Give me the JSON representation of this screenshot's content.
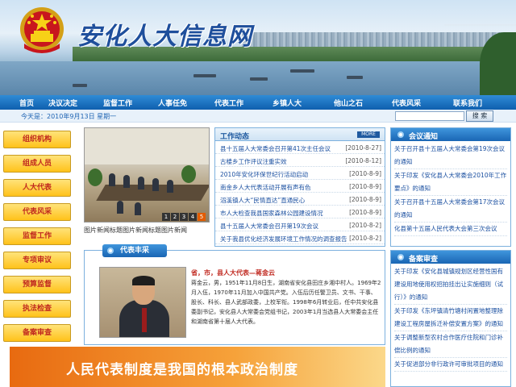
{
  "header": {
    "site_title": "安化人大信息网",
    "emblem_icon": "national-emblem-icon"
  },
  "nav": {
    "items": [
      "首页",
      "决议决定",
      "监督工作",
      "人事任免",
      "代表工作",
      "乡镇人大",
      "他山之石",
      "代表风采",
      "联系我们"
    ]
  },
  "datebar": {
    "date": "今天是：2010年9月13日 星期一",
    "search_value": "",
    "search_button": "搜 索"
  },
  "left_menu": [
    "组织机构",
    "组成人员",
    "人大代表",
    "代表风采",
    "监督工作",
    "专项审议",
    "预算监督",
    "执法检查",
    "备案审查"
  ],
  "slideshow": {
    "caption": "图片新闻标题图片新闻标题图片新闻",
    "pages": [
      "1",
      "2",
      "3",
      "4",
      "5"
    ],
    "active_page": "5"
  },
  "work_news": {
    "title": "工作动态",
    "more": "MORE",
    "items": [
      {
        "title": "县十五届人大常委会召开第41次主任会议",
        "date": "[2010-8-27]"
      },
      {
        "title": "古楼乡工作评议注重实效",
        "date": "[2010-8-12]"
      },
      {
        "title": "2010年安化环保世纪行活动启动",
        "date": "[2010-8-9]"
      },
      {
        "title": "南金乡人大代表活动开展有声有色",
        "date": "[2010-8-9]"
      },
      {
        "title": "滔溪镇人大“民情直达”直通民心",
        "date": "[2010-8-9]"
      },
      {
        "title": "市人大检查我县国家森林公园建设情况",
        "date": "[2010-8-9]"
      },
      {
        "title": "县十五届人大常委会召开第19次会议",
        "date": "[2010-8-2]"
      },
      {
        "title": "关于我县优化经济发展环境工作情况的调查报告",
        "date": "[2010-8-2]"
      }
    ]
  },
  "meeting_notice": {
    "title": "会议通知",
    "items": [
      "关于召开县十五届人大常委会第19次会议的通知",
      "关于印发《安化县人大常委会2010年工作要点》的通知",
      "关于召开县十五届人大常委会第17次会议的通知",
      "化县第十五届人民代表大会第三次会议"
    ]
  },
  "representative": {
    "tab": "代表丰采",
    "name": "省，市，县人大代表—蒋金云",
    "bio": "蒋金云，男，1951年11月8日生，湖南省安化县田庄乡湘中村人。1969年2月入伍，1970年11月加入中国共产党。入伍后历任警卫员、文书、干事、股长、科长、县人武部政委，上校军衔。1998年6月转业后，任中共安化县委副书记，安化县人大常委会党组书记，2003年1月当选县人大常委会主任和湖南省第十届人大代表。"
  },
  "filing_review": {
    "title": "备案审查",
    "items": [
      "关于印发《安化县城镇规划区经营性国有建设用地使用权招拍挂出让实施细则（试行）》的通知",
      "关于印发《东坪镇清竹塘村闲置地整理除建设工程房屋拆迁补偿安置方案》的通知",
      "关于调整新型农村合作医疗住院和门诊补偿比例的通知",
      "关于促进部分非行政许可审批项目的通知"
    ]
  },
  "slogan": "人民代表制度是我国的根本政治制度"
}
